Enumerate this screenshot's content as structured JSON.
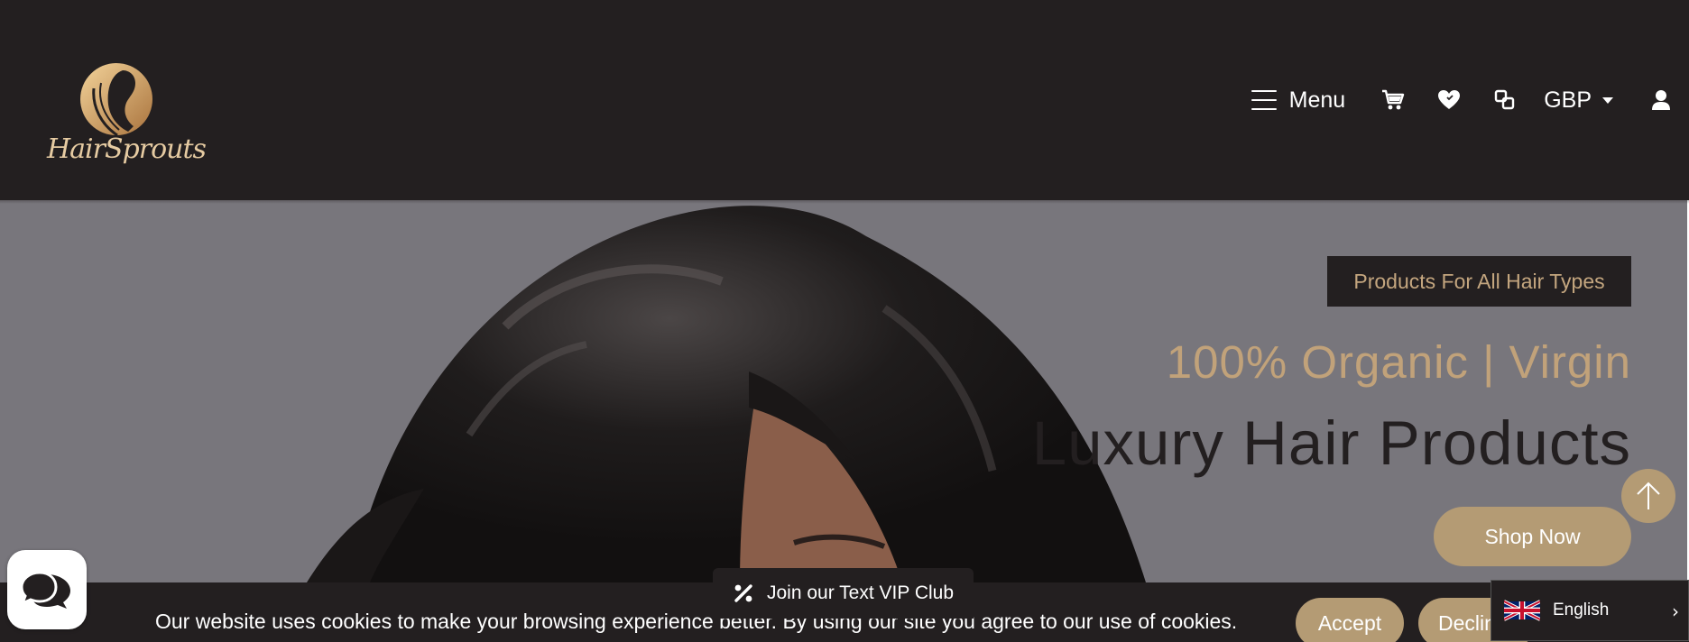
{
  "header": {
    "logo_text": "HairSprouts",
    "nav": {
      "menu_label": "Menu",
      "currency": "GBP",
      "icons": [
        "menu-icon",
        "cart-icon",
        "heart-icon",
        "compare-icon",
        "caret-down-icon",
        "user-icon"
      ]
    }
  },
  "hero": {
    "badge": "Products For All Hair Types",
    "subtitle": "100% Organic | Virgin",
    "title": "Luxury Hair Products",
    "cta_label": "Shop Now"
  },
  "vip_club": {
    "label": "Join our Text VIP Club",
    "icon": "percent-icon"
  },
  "cookie": {
    "message": "Our website uses cookies to make your browsing experience better. By using our site you agree to our use of cookies.",
    "accept_label": "Accept",
    "decline_label": "Decline"
  },
  "language": {
    "selected": "English",
    "icons": [
      "uk-flag-icon",
      "chevron-right-icon"
    ]
  },
  "colors": {
    "header_bg": "#231f20",
    "accent_gold": "#b49b74",
    "hero_bg": "#78767c",
    "badge_text": "#c4a67f"
  }
}
